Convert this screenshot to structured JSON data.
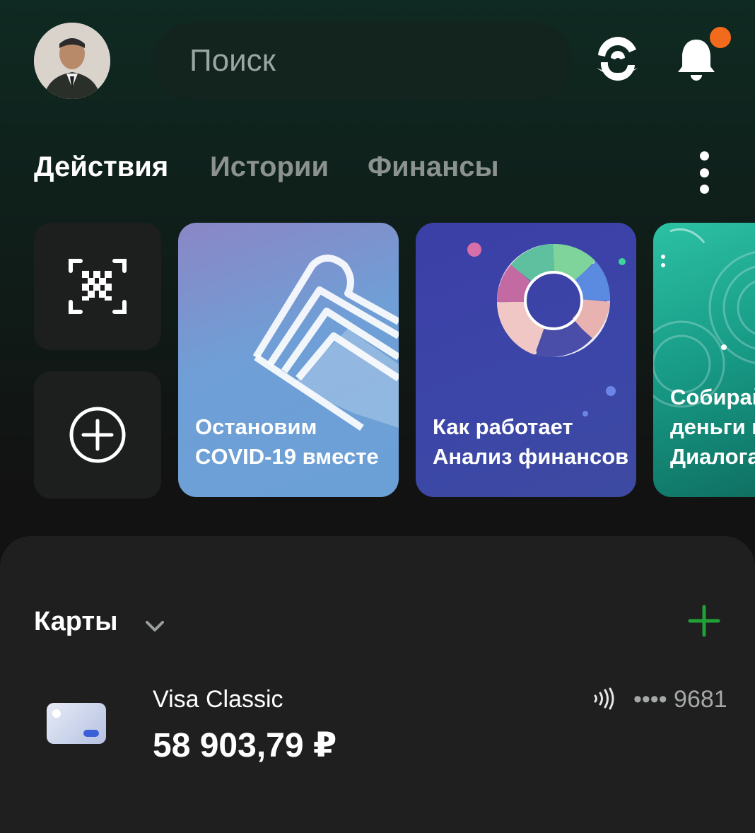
{
  "header": {
    "search_placeholder": "Поиск",
    "notification_dot_color": "#f26a1b"
  },
  "tabs": [
    {
      "label": "Действия",
      "active": true
    },
    {
      "label": "Истории",
      "active": false
    },
    {
      "label": "Финансы",
      "active": false
    }
  ],
  "quick_actions": [
    {
      "icon": "qr-scan-icon"
    },
    {
      "icon": "add-circle-icon"
    }
  ],
  "stories": [
    {
      "title": "Остановим\nCOVID-19 вместе"
    },
    {
      "title": "Как работает\nАнализ финансов"
    },
    {
      "title": "Собирай\nденьги в\nДиалога"
    }
  ],
  "cards_section": {
    "title": "Карты",
    "accent_color": "#21a038"
  },
  "card": {
    "name": "Visa Classic",
    "balance": "58 903,79 ₽",
    "number_masked": "•••• 9681"
  }
}
